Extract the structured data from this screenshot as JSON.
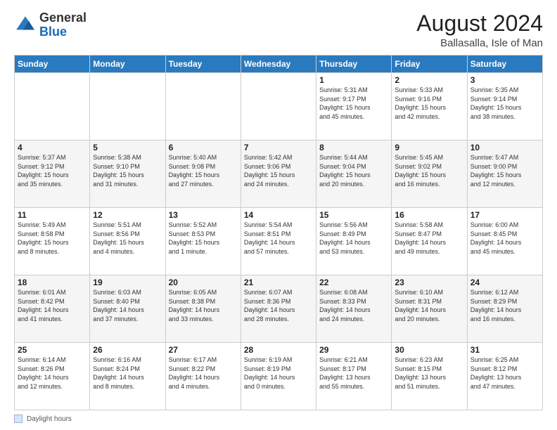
{
  "logo": {
    "general": "General",
    "blue": "Blue"
  },
  "title": "August 2024",
  "location": "Ballasalla, Isle of Man",
  "days_of_week": [
    "Sunday",
    "Monday",
    "Tuesday",
    "Wednesday",
    "Thursday",
    "Friday",
    "Saturday"
  ],
  "footer_legend": "Daylight hours",
  "weeks": [
    [
      {
        "day": "",
        "info": ""
      },
      {
        "day": "",
        "info": ""
      },
      {
        "day": "",
        "info": ""
      },
      {
        "day": "",
        "info": ""
      },
      {
        "day": "1",
        "info": "Sunrise: 5:31 AM\nSunset: 9:17 PM\nDaylight: 15 hours\nand 45 minutes."
      },
      {
        "day": "2",
        "info": "Sunrise: 5:33 AM\nSunset: 9:16 PM\nDaylight: 15 hours\nand 42 minutes."
      },
      {
        "day": "3",
        "info": "Sunrise: 5:35 AM\nSunset: 9:14 PM\nDaylight: 15 hours\nand 38 minutes."
      }
    ],
    [
      {
        "day": "4",
        "info": "Sunrise: 5:37 AM\nSunset: 9:12 PM\nDaylight: 15 hours\nand 35 minutes."
      },
      {
        "day": "5",
        "info": "Sunrise: 5:38 AM\nSunset: 9:10 PM\nDaylight: 15 hours\nand 31 minutes."
      },
      {
        "day": "6",
        "info": "Sunrise: 5:40 AM\nSunset: 9:08 PM\nDaylight: 15 hours\nand 27 minutes."
      },
      {
        "day": "7",
        "info": "Sunrise: 5:42 AM\nSunset: 9:06 PM\nDaylight: 15 hours\nand 24 minutes."
      },
      {
        "day": "8",
        "info": "Sunrise: 5:44 AM\nSunset: 9:04 PM\nDaylight: 15 hours\nand 20 minutes."
      },
      {
        "day": "9",
        "info": "Sunrise: 5:45 AM\nSunset: 9:02 PM\nDaylight: 15 hours\nand 16 minutes."
      },
      {
        "day": "10",
        "info": "Sunrise: 5:47 AM\nSunset: 9:00 PM\nDaylight: 15 hours\nand 12 minutes."
      }
    ],
    [
      {
        "day": "11",
        "info": "Sunrise: 5:49 AM\nSunset: 8:58 PM\nDaylight: 15 hours\nand 8 minutes."
      },
      {
        "day": "12",
        "info": "Sunrise: 5:51 AM\nSunset: 8:56 PM\nDaylight: 15 hours\nand 4 minutes."
      },
      {
        "day": "13",
        "info": "Sunrise: 5:52 AM\nSunset: 8:53 PM\nDaylight: 15 hours\nand 1 minute."
      },
      {
        "day": "14",
        "info": "Sunrise: 5:54 AM\nSunset: 8:51 PM\nDaylight: 14 hours\nand 57 minutes."
      },
      {
        "day": "15",
        "info": "Sunrise: 5:56 AM\nSunset: 8:49 PM\nDaylight: 14 hours\nand 53 minutes."
      },
      {
        "day": "16",
        "info": "Sunrise: 5:58 AM\nSunset: 8:47 PM\nDaylight: 14 hours\nand 49 minutes."
      },
      {
        "day": "17",
        "info": "Sunrise: 6:00 AM\nSunset: 8:45 PM\nDaylight: 14 hours\nand 45 minutes."
      }
    ],
    [
      {
        "day": "18",
        "info": "Sunrise: 6:01 AM\nSunset: 8:42 PM\nDaylight: 14 hours\nand 41 minutes."
      },
      {
        "day": "19",
        "info": "Sunrise: 6:03 AM\nSunset: 8:40 PM\nDaylight: 14 hours\nand 37 minutes."
      },
      {
        "day": "20",
        "info": "Sunrise: 6:05 AM\nSunset: 8:38 PM\nDaylight: 14 hours\nand 33 minutes."
      },
      {
        "day": "21",
        "info": "Sunrise: 6:07 AM\nSunset: 8:36 PM\nDaylight: 14 hours\nand 28 minutes."
      },
      {
        "day": "22",
        "info": "Sunrise: 6:08 AM\nSunset: 8:33 PM\nDaylight: 14 hours\nand 24 minutes."
      },
      {
        "day": "23",
        "info": "Sunrise: 6:10 AM\nSunset: 8:31 PM\nDaylight: 14 hours\nand 20 minutes."
      },
      {
        "day": "24",
        "info": "Sunrise: 6:12 AM\nSunset: 8:29 PM\nDaylight: 14 hours\nand 16 minutes."
      }
    ],
    [
      {
        "day": "25",
        "info": "Sunrise: 6:14 AM\nSunset: 8:26 PM\nDaylight: 14 hours\nand 12 minutes."
      },
      {
        "day": "26",
        "info": "Sunrise: 6:16 AM\nSunset: 8:24 PM\nDaylight: 14 hours\nand 8 minutes."
      },
      {
        "day": "27",
        "info": "Sunrise: 6:17 AM\nSunset: 8:22 PM\nDaylight: 14 hours\nand 4 minutes."
      },
      {
        "day": "28",
        "info": "Sunrise: 6:19 AM\nSunset: 8:19 PM\nDaylight: 14 hours\nand 0 minutes."
      },
      {
        "day": "29",
        "info": "Sunrise: 6:21 AM\nSunset: 8:17 PM\nDaylight: 13 hours\nand 55 minutes."
      },
      {
        "day": "30",
        "info": "Sunrise: 6:23 AM\nSunset: 8:15 PM\nDaylight: 13 hours\nand 51 minutes."
      },
      {
        "day": "31",
        "info": "Sunrise: 6:25 AM\nSunset: 8:12 PM\nDaylight: 13 hours\nand 47 minutes."
      }
    ]
  ]
}
